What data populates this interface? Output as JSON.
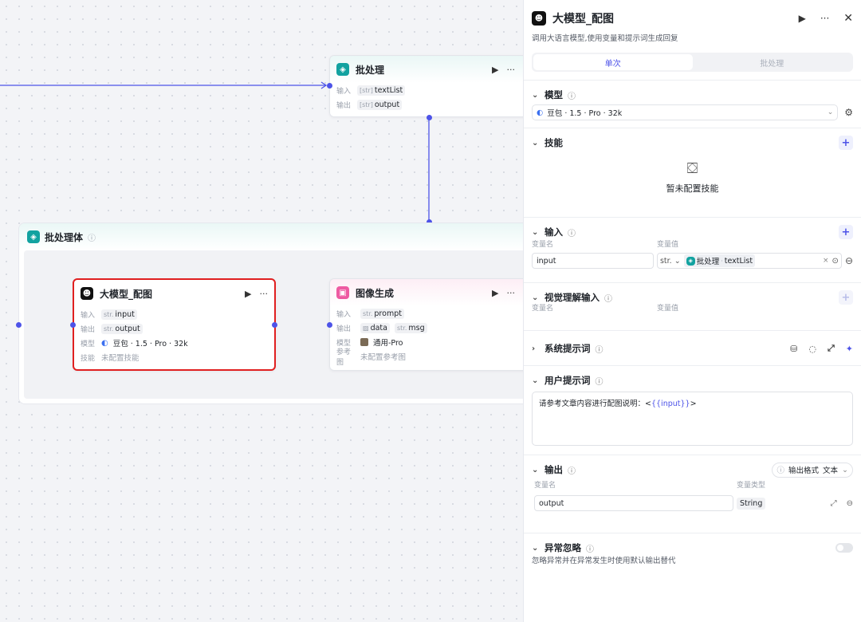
{
  "canvas": {
    "batch_node": {
      "title": "批处理",
      "input_label": "输入",
      "input_type": "[str]",
      "input_var": "textList",
      "output_label": "输出",
      "output_type": "[str]",
      "output_var": "output"
    },
    "batch_body": {
      "title": "批处理体"
    },
    "llm_node": {
      "title": "大模型_配图",
      "input_label": "输入",
      "input_type": "str.",
      "input_var": "input",
      "output_label": "输出",
      "output_type": "str.",
      "output_var": "output",
      "model_label": "模型",
      "model_value": "豆包 · 1.5 · Pro · 32k",
      "skill_label": "技能",
      "skill_value": "未配置技能"
    },
    "image_node": {
      "title": "图像生成",
      "input_label": "输入",
      "input_type": "str.",
      "input_var": "prompt",
      "output_label": "输出",
      "output_var1": "data",
      "output_type2": "str.",
      "output_var2": "msg",
      "model_label": "模型",
      "model_value": "通用-Pro",
      "ref_label": "参考图",
      "ref_value": "未配置参考图"
    }
  },
  "panel": {
    "title": "大模型_配图",
    "description": "调用大语言模型,使用变量和提示词生成回复",
    "tabs": [
      "单次",
      "批处理"
    ],
    "model": {
      "heading": "模型",
      "value": "豆包 · 1.5 · Pro · 32k"
    },
    "skills": {
      "heading": "技能",
      "empty": "暂未配置技能"
    },
    "input": {
      "heading": "输入",
      "col_name": "变量名",
      "col_value": "变量值",
      "var_name": "input",
      "type": "str.",
      "ref_node": "批处理",
      "ref_var": "textList"
    },
    "vision": {
      "heading": "视觉理解输入",
      "col_name": "变量名",
      "col_value": "变量值"
    },
    "system_prompt": {
      "heading": "系统提示词"
    },
    "user_prompt": {
      "heading": "用户提示词",
      "text_prefix": "请参考文章内容进行配图说明：<",
      "text_var": "{{input}}",
      "text_suffix": ">"
    },
    "output": {
      "heading": "输出",
      "format_label": "输出格式",
      "format_value": "文本",
      "col_name": "变量名",
      "col_type": "变量类型",
      "var_name": "output",
      "var_type": "String"
    },
    "error": {
      "heading": "异常忽略",
      "desc": "忽略异常并在异常发生时使用默认输出替代"
    }
  },
  "colors": {
    "accent": "#4d53e8",
    "teal": "#12a2a0",
    "selected": "#e02020",
    "pink": "#ee5aa2"
  }
}
